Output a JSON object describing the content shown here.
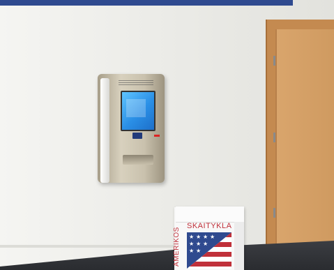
{
  "box": {
    "front_text": "SKAITYKLA",
    "side_text": "AMERIKOS"
  },
  "colors": {
    "wall": "#ecece8",
    "door": "#cf9a60",
    "flag_blue": "#2f4a8f",
    "flag_red": "#c0303a",
    "kiosk_screen": "#2a8fe6"
  },
  "icons": {
    "kiosk": "self-service-kiosk",
    "flag": "us-flag",
    "door": "wooden-door"
  }
}
